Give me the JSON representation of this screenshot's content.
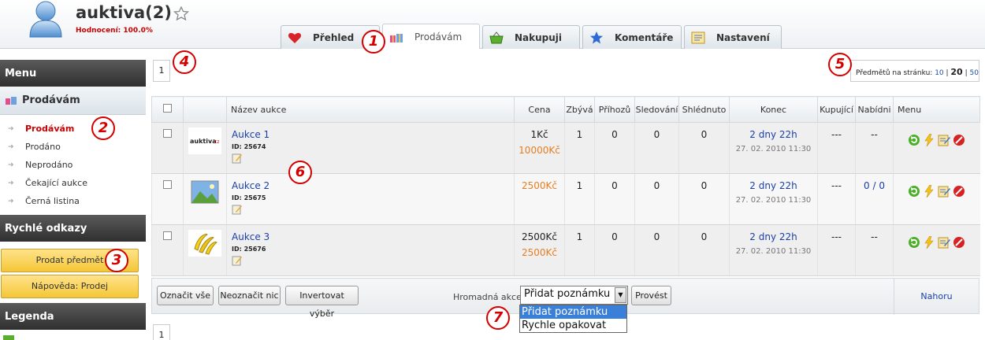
{
  "user": {
    "name": "auktiva(2)",
    "rating": "Hodnocení: 100.0%"
  },
  "tabs": [
    {
      "label": "Přehled",
      "icon": "heart-icon",
      "active": false
    },
    {
      "label": "Prodávám",
      "icon": "gifts-icon",
      "active": true
    },
    {
      "label": "Nakupuji",
      "icon": "basket-icon",
      "active": false
    },
    {
      "label": "Komentáře",
      "icon": "star-icon",
      "active": false
    },
    {
      "label": "Nastavení",
      "icon": "settings-icon",
      "active": false
    }
  ],
  "sidebar": {
    "menu_title": "Menu",
    "section_title": "Prodávám",
    "items": [
      {
        "label": "Prodávám",
        "current": true
      },
      {
        "label": "Prodáno"
      },
      {
        "label": "Neprodáno"
      },
      {
        "label": "Čekající aukce"
      },
      {
        "label": "Černá listina"
      }
    ],
    "quick_links_title": "Rychlé odkazy",
    "quick_links": [
      "Prodat předmět",
      "Nápověda: Prodej"
    ],
    "legend_title": "Legenda"
  },
  "pager": {
    "page": "1"
  },
  "per_page": {
    "label": "Předmětů na stránku:",
    "options": [
      "10",
      "20",
      "50"
    ],
    "selected": "20"
  },
  "table": {
    "headers": [
      "Název aukce",
      "Cena",
      "Zbývá",
      "Příhozů",
      "Sledování",
      "Shlédnuto",
      "Konec",
      "Kupující",
      "Nabídni",
      "Menu"
    ],
    "rows": [
      {
        "thumb": "auktiva-logo",
        "name": "Aukce 1",
        "id": "ID: 25674",
        "price": "1Kč",
        "price2": "10000Kč",
        "remaining": "1",
        "bids": "0",
        "watching": "0",
        "viewed": "0",
        "end": "2 dny 22h",
        "end_date": "27. 02. 2010 11:30",
        "buyer": "---",
        "offer": "--"
      },
      {
        "thumb": "landscape-image",
        "name": "Aukce 2",
        "id": "ID: 25675",
        "price": "",
        "price2": "2500Kč",
        "remaining": "1",
        "bids": "0",
        "watching": "0",
        "viewed": "0",
        "end": "2 dny 22h",
        "end_date": "27. 02. 2010 11:30",
        "buyer": "---",
        "offer": "0 / 0"
      },
      {
        "thumb": "bananas-image",
        "name": "Aukce 3",
        "id": "ID: 25676",
        "price": "2500Kč",
        "price2": "2500Kč",
        "remaining": "1",
        "bids": "0",
        "watching": "0",
        "viewed": "0",
        "end": "2 dny 22h",
        "end_date": "27. 02. 2010 11:30",
        "buyer": "---",
        "offer": "--"
      }
    ]
  },
  "footer": {
    "select_all": "Označit vše",
    "select_none": "Neoznačit nic",
    "invert": "Invertovat výběr",
    "bulk_label": "Hromadná akce:",
    "bulk_selected": "Přidat poznámku",
    "bulk_options": [
      "Přidat poznámku",
      "Rychle opakovat"
    ],
    "go": "Provést",
    "top": "Nahoru"
  },
  "markers": [
    "1",
    "2",
    "3",
    "4",
    "5",
    "6",
    "7"
  ],
  "colors": {
    "accent_red": "#d40000",
    "link": "#1a3fa8",
    "price_orange": "#e67e22",
    "quick_btn": "#f4c637"
  }
}
